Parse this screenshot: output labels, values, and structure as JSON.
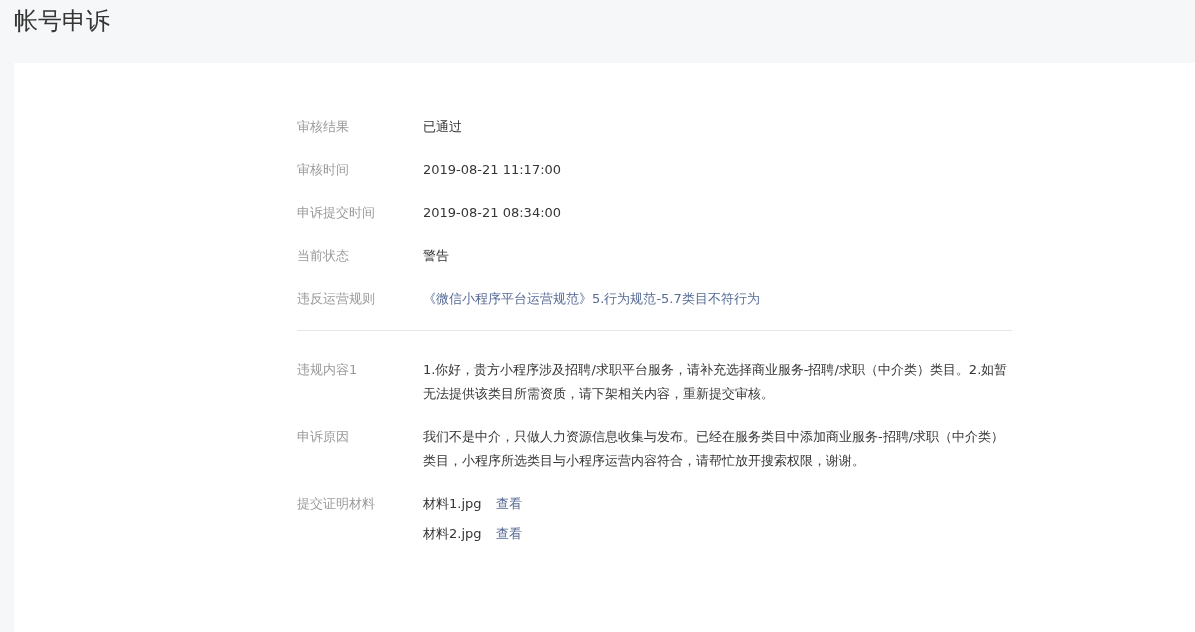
{
  "title": "帐号申诉",
  "summary": [
    {
      "label": "审核结果",
      "value": "已通过",
      "kind": "status"
    },
    {
      "label": "审核时间",
      "value": "2019-08-21 11:17:00",
      "kind": "text"
    },
    {
      "label": "申诉提交时间",
      "value": "2019-08-21 08:34:00",
      "kind": "text"
    },
    {
      "label": "当前状态",
      "value": "警告",
      "kind": "text"
    },
    {
      "label": "违反运营规则",
      "value": "《微信小程序平台运营规范》5.行为规范-5.7类目不符行为",
      "kind": "link"
    }
  ],
  "details": [
    {
      "label": "违规内容1",
      "value": "1.你好，贵方小程序涉及招聘/求职平台服务，请补充选择商业服务-招聘/求职（中介类）类目。2.如暂无法提供该类目所需资质，请下架相关内容，重新提交审核。"
    },
    {
      "label": "申诉原因",
      "value": "我们不是中介，只做人力资源信息收集与发布。已经在服务类目中添加商业服务-招聘/求职（中介类）类目，小程序所选类目与小程序运营内容符合，请帮忙放开搜索权限，谢谢。"
    }
  ],
  "materials": {
    "label": "提交证明材料",
    "files": [
      {
        "name": "材料1.jpg",
        "action": "查看"
      },
      {
        "name": "材料2.jpg",
        "action": "查看"
      }
    ]
  }
}
